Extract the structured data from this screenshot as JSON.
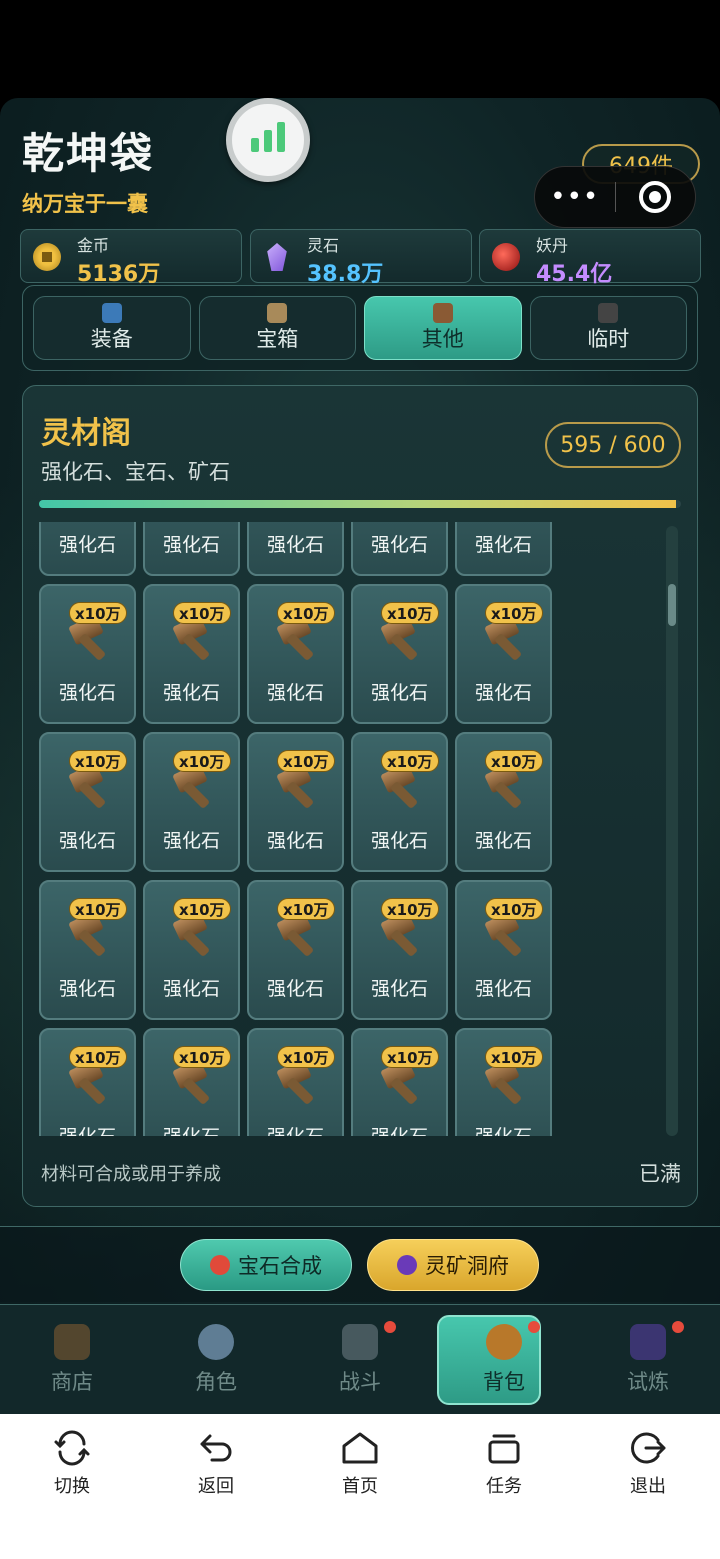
{
  "header": {
    "title": "乾坤袋",
    "subtitle": "纳万宝于一囊",
    "item_count": "649件"
  },
  "capsule": {
    "more_icon": "more-dots-icon",
    "close_icon": "target-icon"
  },
  "currencies": [
    {
      "label": "金币",
      "value": "5136万",
      "icon": "gold-coin-icon",
      "color": "#f1c24a"
    },
    {
      "label": "灵石",
      "value": "38.8万",
      "icon": "spirit-stone-icon",
      "color": "#55c3ff"
    },
    {
      "label": "妖丹",
      "value": "45.4亿",
      "icon": "demon-core-icon",
      "color": "#c48cff"
    }
  ],
  "tabs": [
    {
      "label": "装备",
      "active": false
    },
    {
      "label": "宝箱",
      "active": false
    },
    {
      "label": "其他",
      "active": true
    },
    {
      "label": "临时",
      "active": false
    }
  ],
  "panel": {
    "title": "灵材阁",
    "subtitle": "强化石、宝石、矿石",
    "capacity": "595 / 600",
    "fill_fraction": 0.992,
    "footer_left": "材料可合成或用于养成",
    "footer_right": "已满"
  },
  "grid": {
    "item_name": "强化石",
    "badge": "x10万",
    "rows": 5,
    "cols": 5
  },
  "actions": {
    "gem_synthesis": "宝石合成",
    "spirit_mine": "灵矿洞府"
  },
  "nav": [
    {
      "label": "商店",
      "icon": "shop-icon",
      "dot": false,
      "active": false
    },
    {
      "label": "角色",
      "icon": "character-icon",
      "dot": false,
      "active": false
    },
    {
      "label": "战斗",
      "icon": "battle-swords-icon",
      "dot": true,
      "active": false
    },
    {
      "label": "背包",
      "icon": "bag-icon",
      "dot": true,
      "active": true
    },
    {
      "label": "试炼",
      "icon": "trial-tower-icon",
      "dot": true,
      "active": false
    }
  ],
  "system": [
    {
      "label": "切换",
      "icon": "switch-icon"
    },
    {
      "label": "返回",
      "icon": "back-icon"
    },
    {
      "label": "首页",
      "icon": "home-icon"
    },
    {
      "label": "任务",
      "icon": "tasks-icon"
    },
    {
      "label": "退出",
      "icon": "exit-icon"
    }
  ]
}
